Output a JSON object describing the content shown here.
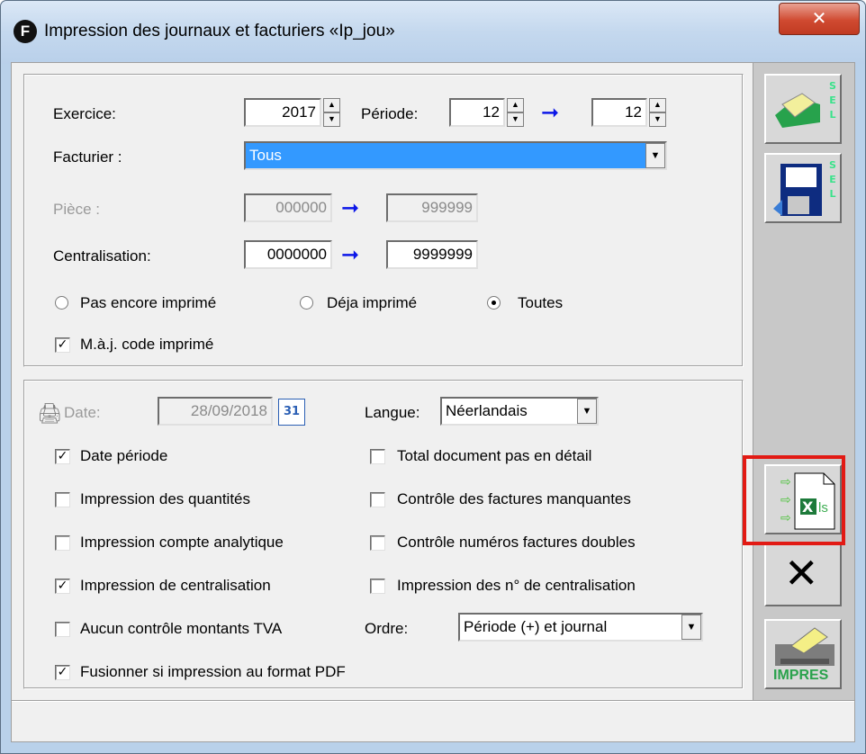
{
  "window": {
    "title": "Impression des journaux et facturiers «Ip_jou»",
    "app_icon": "F",
    "close_label": "✕"
  },
  "top_panel": {
    "exercice_label": "Exercice:",
    "exercice_value": "2017",
    "periode_label": "Période:",
    "periode_from": "12",
    "periode_to": "12",
    "facturier_label": "Facturier :",
    "facturier_value": "Tous",
    "piece_label": "Pièce :",
    "piece_from": "000000",
    "piece_to": "999999",
    "centralisation_label": "Centralisation:",
    "centralisation_from": "0000000",
    "centralisation_to": "9999999",
    "radio_pas_encore": "Pas encore imprimé",
    "radio_deja": "Déja imprimé",
    "radio_toutes": "Toutes",
    "maj_code": "M.à.j. code imprimé"
  },
  "bottom_panel": {
    "date_label": "Date:",
    "date_value": "28/09/2018",
    "calendar_icon_text": "31",
    "langue_label": "Langue:",
    "langue_value": "Néerlandais",
    "date_periode": "Date période",
    "total_document": "Total document pas en détail",
    "impression_quantites": "Impression des quantités",
    "controle_manquantes": "Contrôle des factures manquantes",
    "impression_analytique": "Impression compte analytique",
    "controle_doubles": "Contrôle numéros factures doubles",
    "impression_centralisation": "Impression de centralisation",
    "impression_n_centralisation": "Impression des n° de centralisation",
    "aucun_controle_tva": "Aucun contrôle montants TVA",
    "ordre_label": "Ordre:",
    "ordre_value": "Période (+) et journal",
    "fusionner_pdf": "Fusionner si impression au format PDF"
  },
  "toolbar": {
    "sel_strip_1": "S E L",
    "sel_strip_2": "S E L",
    "xls_label": "ls",
    "cancel_label": "✕",
    "impres_label": "IMPRES"
  },
  "colors": {
    "arrow": "#0b16e8",
    "highlight": "#e21a14",
    "selected_dropdown": "#3399ff"
  }
}
